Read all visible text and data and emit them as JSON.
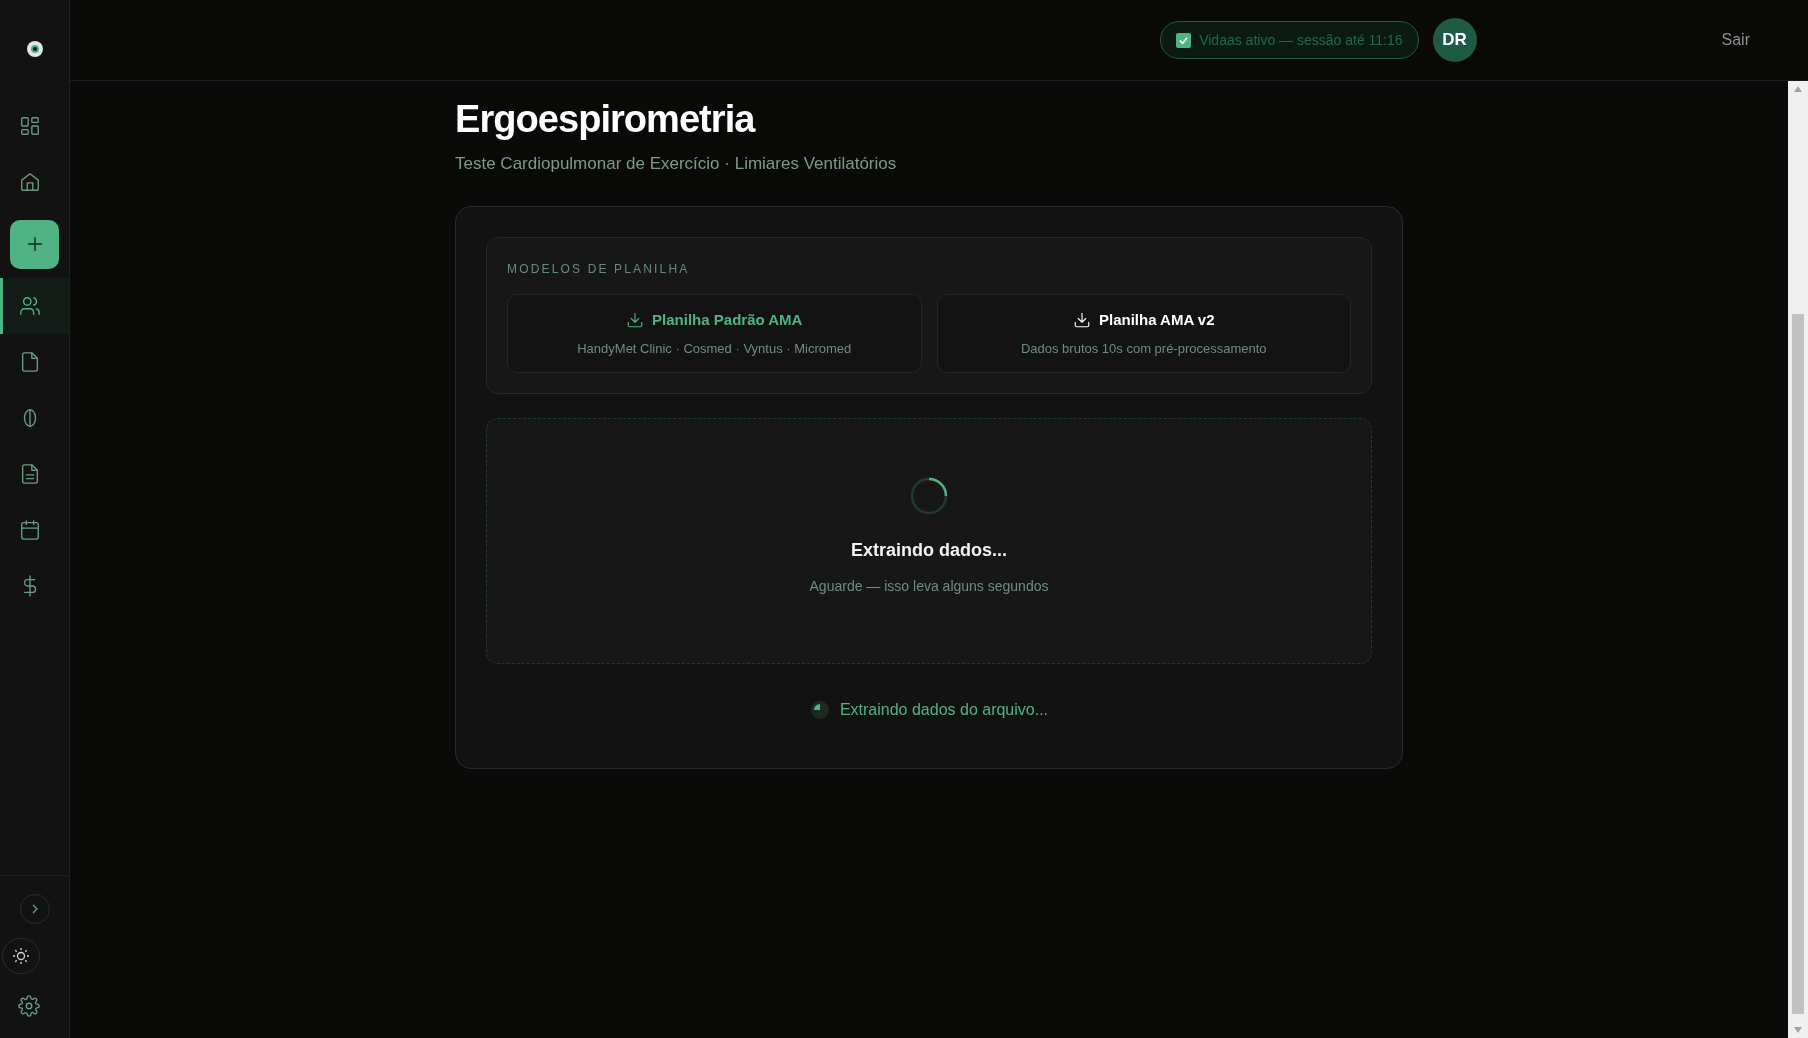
{
  "sidebar": {
    "items": [
      {
        "kind": "nav",
        "selected": false
      },
      {
        "kind": "nav",
        "selected": false
      },
      {
        "kind": "action",
        "selected": false
      },
      {
        "kind": "nav",
        "selected": true
      },
      {
        "kind": "nav",
        "selected": false
      },
      {
        "kind": "nav",
        "selected": false
      },
      {
        "kind": "nav",
        "selected": false
      },
      {
        "kind": "nav",
        "selected": false
      },
      {
        "kind": "nav",
        "selected": false
      }
    ]
  },
  "header": {
    "session": {
      "checked": true,
      "label": "Vidaas ativo — sessão até 11:16"
    },
    "avatar": "DR",
    "logout": "Sair"
  },
  "page": {
    "title": "Ergoespirometria",
    "subtitle": "Teste Cardiopulmonar de Exercício · Limiares Ventilatórios"
  },
  "templates": {
    "heading": "MODELOS DE PLANILHA",
    "items": [
      {
        "title": "Planilha Padrão AMA",
        "description": "HandyMet Clinic · Cosmed · Vyntus · Micromed",
        "selected": true
      },
      {
        "title": "Planilha AMA v2",
        "description": "Dados brutos 10s com pré-processamento",
        "selected": false
      }
    ]
  },
  "loader": {
    "title": "Extraindo dados...",
    "message": "Aguarde — isso leva alguns segundos"
  },
  "status": "Extraindo dados do arquivo..."
}
